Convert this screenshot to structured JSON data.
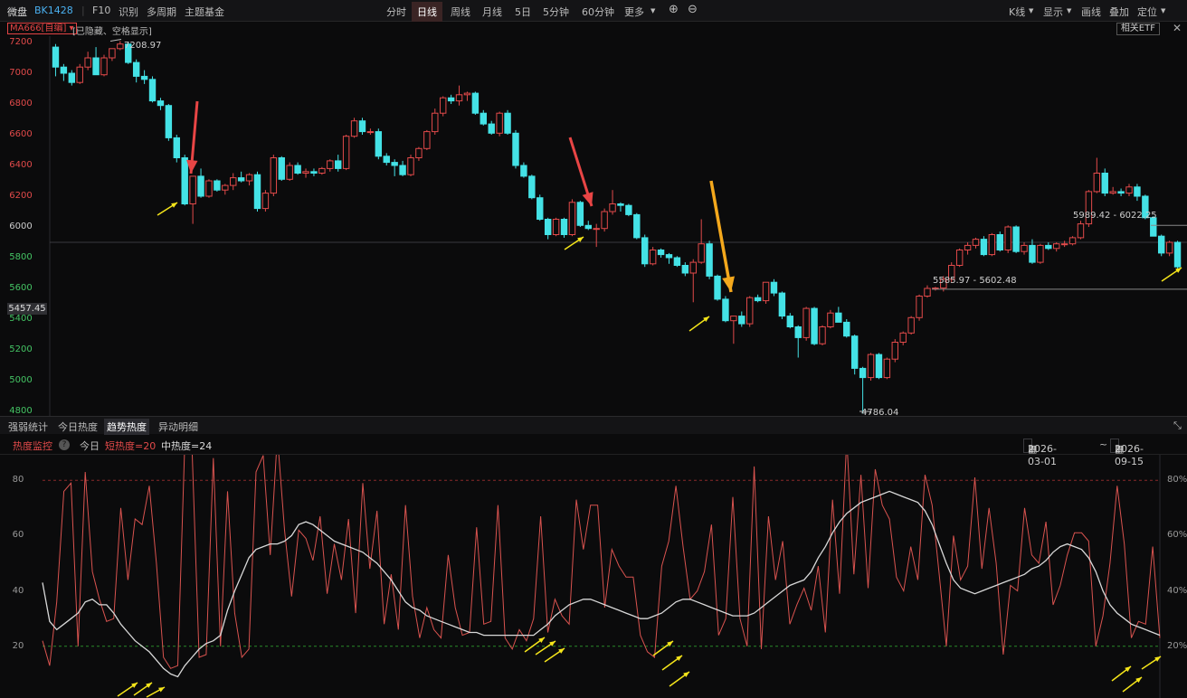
{
  "topbar": {
    "mode": "微盘",
    "code": "BK1428",
    "left_items": [
      "F10",
      "识别",
      "多周期",
      "主题基金"
    ],
    "periods": [
      "分时",
      "日线",
      "周线",
      "月线",
      "5日",
      "5分钟",
      "60分钟",
      "更多"
    ],
    "active_period": "日线",
    "right_items": [
      "K线",
      "显示",
      "画线",
      "叠加",
      "定位"
    ]
  },
  "indicator": {
    "ma_label": "MA666[自编]",
    "note": "[已隐藏、空格显示]",
    "etf_button": "相关ETF",
    "close_glyph": "✕"
  },
  "price_axis": [
    "7200",
    "7000",
    "6800",
    "6600",
    "6400",
    "6200",
    "6000",
    "5800",
    "5600",
    "5400",
    "5200",
    "5000",
    "4800"
  ],
  "current_price": "5457.45",
  "annotations": {
    "high": "7208.97",
    "low": "4786.04",
    "zone_upper": "5989.42 - 6022.25",
    "zone_lower": "5585.97 - 5602.48"
  },
  "tabs": [
    "强弱统计",
    "今日热度",
    "趋势热度",
    "异动明细"
  ],
  "active_tab": "趋势热度",
  "heat_header": {
    "title": "热度监控",
    "help": "?",
    "today": "今日",
    "short": "短热度=20",
    "mid": "中热度=24",
    "date_from": "2026-03-01",
    "date_sep": "~",
    "date_to": "2026-09-15"
  },
  "heat_axis_left": [
    "80",
    "60",
    "40",
    "20"
  ],
  "heat_axis_right": [
    "80%",
    "60%",
    "40%",
    "20%"
  ],
  "colors": {
    "up": "#e24a4a",
    "down": "#44e2e6",
    "short_line": "#d9534f",
    "mid_line": "#d8d8d8",
    "arrow_small": "#f5e51a",
    "arrow_red": "#e84545",
    "arrow_orange": "#f4a81c"
  },
  "chart_data": [
    {
      "type": "candlestick",
      "title": "BK1428",
      "y_range": [
        4800,
        7200
      ],
      "y_ticks": [
        7200,
        7000,
        6800,
        6600,
        6400,
        6200,
        6000,
        5800,
        5600,
        5400,
        5200,
        5000,
        4800
      ],
      "ohlc_approx_from_gridlines": [
        [
          7170,
          7190,
          6980,
          7040
        ],
        [
          7040,
          7060,
          6950,
          7000
        ],
        [
          7000,
          7020,
          6920,
          6940
        ],
        [
          6940,
          7060,
          6930,
          7040
        ],
        [
          7040,
          7140,
          7020,
          7100
        ],
        [
          7100,
          7170,
          7060,
          6990
        ],
        [
          6990,
          7120,
          6980,
          7100
        ],
        [
          7100,
          7160,
          7080,
          7160
        ],
        [
          7160,
          7208.97,
          7150,
          7190
        ],
        [
          7190,
          7200,
          7060,
          7070
        ],
        [
          7070,
          7090,
          6940,
          6980
        ],
        [
          6980,
          7020,
          6930,
          6960
        ],
        [
          6960,
          6980,
          6810,
          6820
        ],
        [
          6820,
          6840,
          6760,
          6790
        ],
        [
          6790,
          6800,
          6560,
          6580
        ],
        [
          6580,
          6600,
          6420,
          6450
        ],
        [
          6450,
          6470,
          6140,
          6150
        ],
        [
          6150,
          6160,
          6020,
          6330
        ],
        [
          6330,
          6380,
          6190,
          6200
        ],
        [
          6200,
          6310,
          6190,
          6300
        ],
        [
          6300,
          6310,
          6230,
          6240
        ],
        [
          6240,
          6280,
          6210,
          6270
        ],
        [
          6270,
          6350,
          6240,
          6320
        ],
        [
          6320,
          6360,
          6290,
          6300
        ],
        [
          6300,
          6350,
          6270,
          6340
        ],
        [
          6340,
          6360,
          6100,
          6120
        ],
        [
          6120,
          6240,
          6100,
          6220
        ],
        [
          6220,
          6470,
          6200,
          6450
        ],
        [
          6450,
          6460,
          6300,
          6310
        ],
        [
          6310,
          6420,
          6300,
          6400
        ],
        [
          6400,
          6420,
          6340,
          6350
        ],
        [
          6350,
          6380,
          6320,
          6360
        ],
        [
          6360,
          6380,
          6330,
          6350
        ],
        [
          6350,
          6390,
          6340,
          6380
        ],
        [
          6380,
          6440,
          6360,
          6430
        ],
        [
          6430,
          6470,
          6360,
          6380
        ],
        [
          6380,
          6600,
          6370,
          6590
        ],
        [
          6590,
          6710,
          6580,
          6690
        ],
        [
          6690,
          6710,
          6600,
          6620
        ],
        [
          6620,
          6640,
          6600,
          6620
        ],
        [
          6620,
          6640,
          6440,
          6460
        ],
        [
          6460,
          6480,
          6400,
          6420
        ],
        [
          6420,
          6440,
          6330,
          6400
        ],
        [
          6400,
          6430,
          6330,
          6340
        ],
        [
          6340,
          6470,
          6330,
          6450
        ],
        [
          6450,
          6520,
          6430,
          6510
        ],
        [
          6510,
          6630,
          6500,
          6620
        ],
        [
          6620,
          6770,
          6600,
          6740
        ],
        [
          6740,
          6850,
          6720,
          6840
        ],
        [
          6840,
          6860,
          6800,
          6820
        ],
        [
          6820,
          6920,
          6790,
          6860
        ],
        [
          6860,
          6880,
          6820,
          6870
        ],
        [
          6870,
          6880,
          6730,
          6740
        ],
        [
          6740,
          6760,
          6660,
          6670
        ],
        [
          6670,
          6690,
          6600,
          6610
        ],
        [
          6610,
          6750,
          6590,
          6740
        ],
        [
          6740,
          6760,
          6600,
          6610
        ],
        [
          6610,
          6630,
          6380,
          6400
        ],
        [
          6400,
          6420,
          6320,
          6330
        ],
        [
          6330,
          6340,
          6180,
          6190
        ],
        [
          6190,
          6210,
          6040,
          6050
        ],
        [
          6050,
          6060,
          5920,
          5950
        ],
        [
          5950,
          6060,
          5940,
          6050
        ],
        [
          6050,
          6060,
          5930,
          5950
        ],
        [
          5950,
          6180,
          5940,
          6160
        ],
        [
          6160,
          6170,
          6000,
          6010
        ],
        [
          6010,
          6040,
          5980,
          5990
        ],
        [
          5990,
          6020,
          5870,
          5990
        ],
        [
          5990,
          6120,
          5970,
          6100
        ],
        [
          6100,
          6240,
          6080,
          6150
        ],
        [
          6150,
          6160,
          6100,
          6140
        ],
        [
          6140,
          6150,
          6070,
          6080
        ],
        [
          6080,
          6090,
          5920,
          5930
        ],
        [
          5930,
          5950,
          5740,
          5760
        ],
        [
          5760,
          5870,
          5750,
          5850
        ],
        [
          5850,
          5860,
          5800,
          5820
        ],
        [
          5820,
          5830,
          5760,
          5800
        ],
        [
          5800,
          5810,
          5740,
          5750
        ],
        [
          5750,
          5770,
          5680,
          5700
        ],
        [
          5700,
          5790,
          5510,
          5770
        ],
        [
          5770,
          6050,
          5760,
          5890
        ],
        [
          5890,
          5910,
          5660,
          5680
        ],
        [
          5680,
          5690,
          5520,
          5530
        ],
        [
          5530,
          5550,
          5380,
          5390
        ],
        [
          5390,
          5420,
          5240,
          5420
        ],
        [
          5420,
          5450,
          5350,
          5370
        ],
        [
          5370,
          5550,
          5350,
          5540
        ],
        [
          5540,
          5560,
          5510,
          5520
        ],
        [
          5520,
          5640,
          5500,
          5640
        ],
        [
          5640,
          5660,
          5550,
          5570
        ],
        [
          5570,
          5580,
          5400,
          5420
        ],
        [
          5420,
          5440,
          5340,
          5350
        ],
        [
          5350,
          5360,
          5150,
          5280
        ],
        [
          5280,
          5480,
          5260,
          5470
        ],
        [
          5470,
          5480,
          5230,
          5240
        ],
        [
          5240,
          5360,
          5230,
          5350
        ],
        [
          5350,
          5460,
          5340,
          5440
        ],
        [
          5440,
          5480,
          5380,
          5380
        ],
        [
          5380,
          5400,
          5280,
          5290
        ],
        [
          5290,
          5300,
          5040,
          5080
        ],
        [
          5080,
          5090,
          4786.04,
          5020
        ],
        [
          5020,
          5180,
          5000,
          5170
        ],
        [
          5170,
          5180,
          5010,
          5020
        ],
        [
          5020,
          5150,
          5010,
          5140
        ],
        [
          5140,
          5270,
          5120,
          5250
        ],
        [
          5250,
          5320,
          5230,
          5310
        ],
        [
          5310,
          5420,
          5300,
          5410
        ],
        [
          5410,
          5560,
          5390,
          5550
        ],
        [
          5550,
          5620,
          5540,
          5600
        ],
        [
          5600,
          5610,
          5585.97,
          5602.48
        ],
        [
          5602.48,
          5680,
          5580,
          5660
        ],
        [
          5660,
          5770,
          5640,
          5750
        ],
        [
          5750,
          5860,
          5740,
          5850
        ],
        [
          5850,
          5900,
          5820,
          5880
        ],
        [
          5880,
          5930,
          5860,
          5920
        ],
        [
          5920,
          5940,
          5810,
          5820
        ],
        [
          5820,
          5960,
          5810,
          5950
        ],
        [
          5950,
          5970,
          5840,
          5850
        ],
        [
          5850,
          6010,
          5830,
          6000
        ],
        [
          6000,
          6010,
          5830,
          5840
        ],
        [
          5840,
          5900,
          5820,
          5880
        ],
        [
          5880,
          5920,
          5760,
          5770
        ],
        [
          5770,
          5890,
          5760,
          5880
        ],
        [
          5880,
          5900,
          5850,
          5860
        ],
        [
          5860,
          5900,
          5840,
          5890
        ],
        [
          5890,
          5910,
          5870,
          5890
        ],
        [
          5890,
          5940,
          5880,
          5930
        ],
        [
          5930,
          6040,
          5920,
          6020
        ],
        [
          6020,
          6240,
          6000,
          6230
        ],
        [
          6230,
          6450,
          6220,
          6350
        ],
        [
          6350,
          6380,
          6200,
          6220
        ],
        [
          6220,
          6260,
          6210,
          6230
        ],
        [
          6230,
          6250,
          6200,
          6220
        ],
        [
          6220,
          6280,
          6200,
          6260
        ],
        [
          6260,
          6280,
          6170,
          6200
        ],
        [
          6200,
          6210,
          6050,
          6060
        ],
        [
          6060,
          6070,
          5940,
          5940
        ],
        [
          5940,
          5950,
          5810,
          5830
        ],
        [
          5830,
          5910,
          5810,
          5900
        ],
        [
          5900,
          5910,
          5730,
          5740
        ]
      ]
    },
    {
      "type": "line",
      "y_range": [
        0,
        100
      ],
      "reference_lines": [
        80,
        20
      ],
      "series": [
        {
          "name": "短热度",
          "values": [
            22,
            13,
            36,
            76,
            79,
            20,
            83,
            47,
            37,
            29,
            30,
            70,
            44,
            66,
            64,
            78,
            50,
            16,
            12,
            13,
            94,
            92,
            16,
            17,
            88,
            20,
            76,
            32,
            16,
            19,
            83,
            89,
            53,
            96,
            62,
            38,
            62,
            59,
            51,
            67,
            39,
            57,
            44,
            66,
            32,
            79,
            48,
            69,
            28,
            46,
            26,
            71,
            38,
            23,
            34,
            26,
            23,
            53,
            34,
            24,
            25,
            63,
            28,
            29,
            71,
            23,
            19,
            26,
            22,
            30,
            67,
            25,
            37,
            31,
            28,
            73,
            55,
            71,
            71,
            34,
            55,
            49,
            45,
            45,
            24,
            18,
            16,
            49,
            58,
            78,
            56,
            37,
            40,
            47,
            64,
            24,
            30,
            74,
            30,
            20,
            85,
            19,
            67,
            44,
            58,
            28,
            35,
            41,
            33,
            49,
            25,
            73,
            39,
            95,
            46,
            82,
            41,
            84,
            71,
            66,
            45,
            40,
            56,
            44,
            82,
            71,
            46,
            20,
            60,
            44,
            49,
            81,
            48,
            70,
            50,
            17,
            42,
            40,
            70,
            53,
            50,
            65,
            35,
            42,
            53,
            61,
            61,
            58,
            20,
            31,
            50,
            78,
            57,
            23,
            29,
            28,
            56,
            23
          ]
        },
        {
          "name": "中热度",
          "values": [
            43,
            29,
            26,
            28,
            30,
            32,
            36,
            37,
            35,
            35,
            32,
            28,
            25,
            22,
            20,
            18,
            15,
            12,
            10,
            9,
            13,
            16,
            19,
            21,
            22,
            24,
            33,
            40,
            46,
            52,
            55,
            56,
            57,
            57,
            58,
            60,
            64,
            65,
            64,
            62,
            60,
            58,
            57,
            56,
            55,
            54,
            52,
            50,
            47,
            44,
            40,
            36,
            34,
            33,
            31,
            30,
            29,
            28,
            27,
            26,
            25,
            25,
            24,
            24,
            24,
            24,
            24,
            24,
            24,
            24,
            26,
            28,
            31,
            33,
            35,
            36,
            37,
            37,
            36,
            35,
            34,
            33,
            32,
            31,
            30,
            30,
            31,
            32,
            34,
            36,
            37,
            37,
            36,
            35,
            34,
            33,
            32,
            31,
            31,
            31,
            32,
            34,
            36,
            38,
            40,
            42,
            43,
            44,
            47,
            52,
            56,
            61,
            65,
            68,
            70,
            72,
            73,
            74,
            75,
            76,
            75,
            74,
            73,
            72,
            69,
            64,
            57,
            50,
            44,
            41,
            40,
            39,
            40,
            41,
            42,
            43,
            44,
            45,
            46,
            48,
            49,
            51,
            54,
            56,
            57,
            56,
            55,
            52,
            47,
            40,
            35,
            32,
            30,
            28,
            27,
            26,
            25,
            24
          ]
        }
      ]
    }
  ]
}
